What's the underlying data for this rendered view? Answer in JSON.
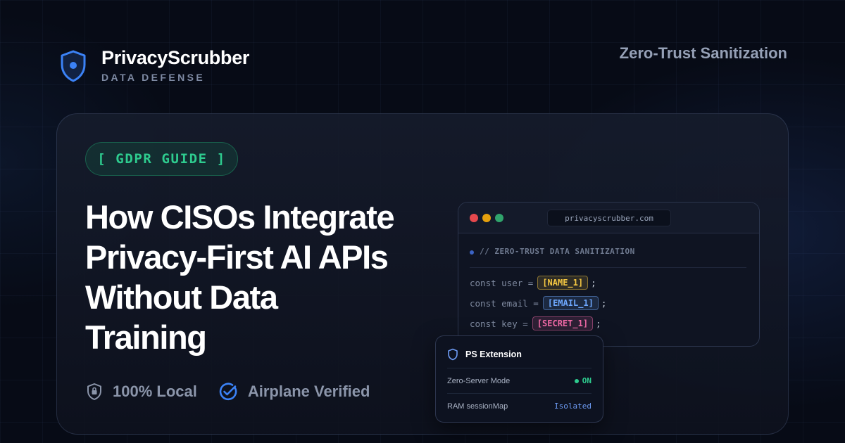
{
  "brand": {
    "name": "PrivacyScrubber",
    "tagline": "DATA DEFENSE",
    "icon": "shield-icon"
  },
  "header": {
    "right_text": "Zero-Trust Sanitization"
  },
  "article": {
    "tag": "[ GDPR GUIDE ]",
    "headline_lines": [
      "How CISOs Integrate",
      "Privacy-First AI APIs",
      "Without Data",
      "Training"
    ],
    "badges": [
      {
        "label": "100% Local",
        "icon": "shield-lock-icon"
      },
      {
        "label": "Airplane Verified",
        "icon": "check-circle-icon"
      }
    ]
  },
  "browser": {
    "url": "privacyscrubber.com",
    "comment": "// ZERO-TRUST DATA SANITIZATION",
    "code_lines": [
      {
        "prefix": "const user = ",
        "token": "[NAME_1]",
        "suffix": ";"
      },
      {
        "prefix": "const email = ",
        "token": "[EMAIL_1]",
        "suffix": ";"
      },
      {
        "prefix": "const key = ",
        "token": "[SECRET_1]",
        "suffix": ";"
      }
    ]
  },
  "extension": {
    "title": "PS Extension",
    "rows": [
      {
        "label": "Zero-Server Mode",
        "value": "ON"
      },
      {
        "label": "RAM sessionMap",
        "value": "Isolated"
      }
    ]
  },
  "colors": {
    "accent_blue": "#3b82f6",
    "accent_green": "#2ecc8f",
    "token_name": "#f5c842",
    "token_email": "#6ea8ff",
    "token_secret": "#f36ba8"
  }
}
